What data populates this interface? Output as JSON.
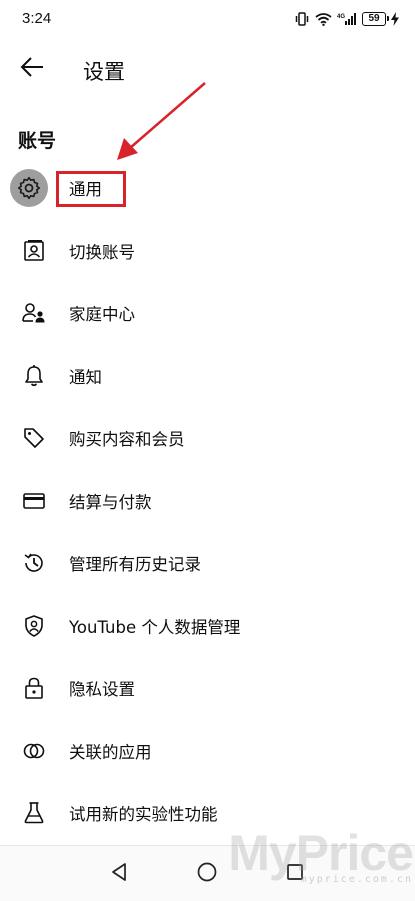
{
  "status_bar": {
    "time": "3:24",
    "battery": "59",
    "icons": [
      "vibrate-icon",
      "wifi-icon",
      "signal-4g-icon",
      "charging-icon"
    ]
  },
  "header": {
    "back_icon": "arrow-left-icon",
    "title": "设置"
  },
  "section": {
    "title": "账号"
  },
  "menu": {
    "items": [
      {
        "label": "通用",
        "icon": "gear-icon"
      },
      {
        "label": "切换账号",
        "icon": "account-card-icon"
      },
      {
        "label": "家庭中心",
        "icon": "family-icon"
      },
      {
        "label": "通知",
        "icon": "bell-icon"
      },
      {
        "label": "购买内容和会员",
        "icon": "tag-icon"
      },
      {
        "label": "结算与付款",
        "icon": "credit-card-icon"
      },
      {
        "label": "管理所有历史记录",
        "icon": "history-icon"
      },
      {
        "label": "YouTube 个人数据管理",
        "icon": "shield-person-icon"
      },
      {
        "label": "隐私设置",
        "icon": "lock-icon"
      },
      {
        "label": "关联的应用",
        "icon": "linked-circles-icon"
      },
      {
        "label": "试用新的实验性功能",
        "icon": "flask-icon"
      }
    ]
  },
  "annotation": {
    "highlight_color": "#d8232a"
  },
  "nav_bar": {
    "icons": [
      "nav-back-icon",
      "nav-home-icon",
      "nav-recents-icon"
    ]
  },
  "watermark": {
    "logo": "MyPrice",
    "url": "myprice.com.cn"
  }
}
